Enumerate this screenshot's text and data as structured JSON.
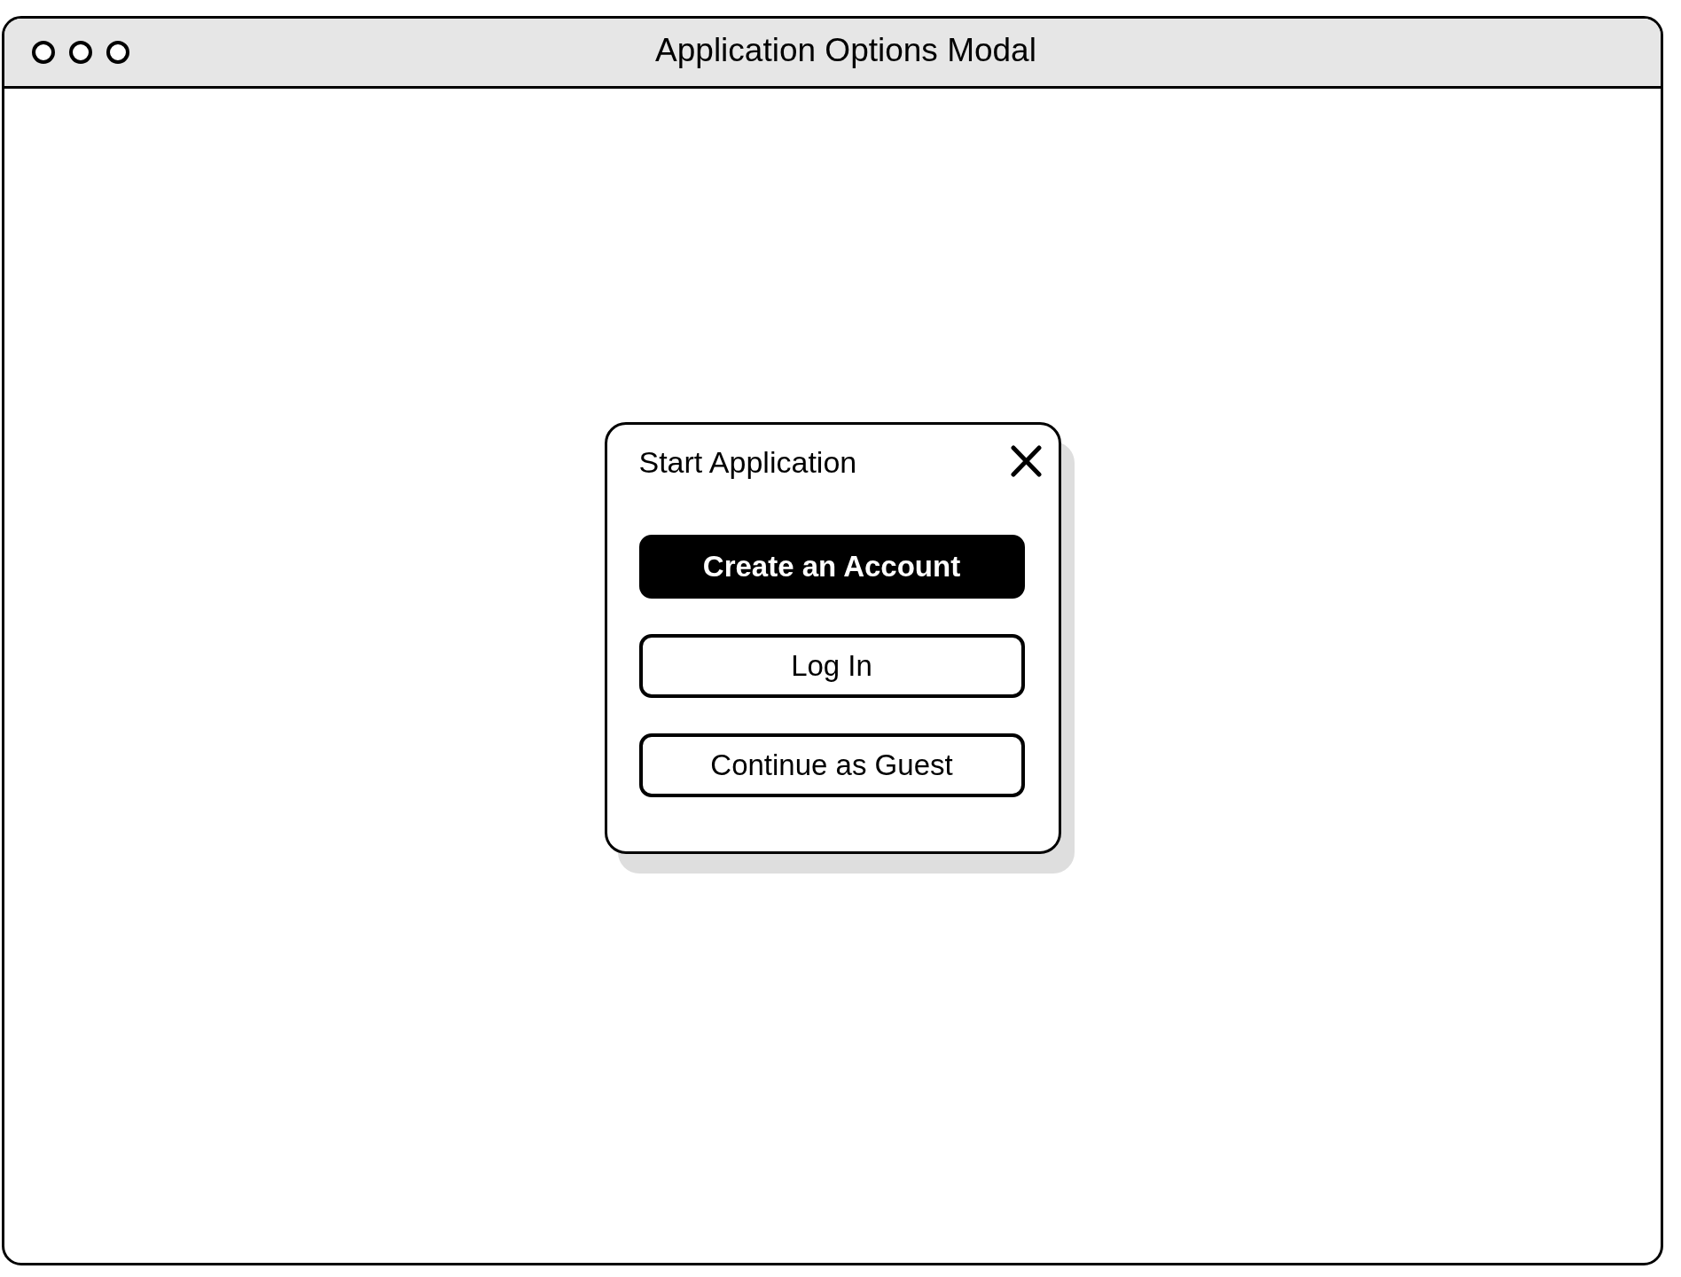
{
  "window": {
    "title": "Application Options Modal"
  },
  "modal": {
    "title": "Start Application",
    "buttons": [
      {
        "label": "Create an Account",
        "kind": "primary"
      },
      {
        "label": "Log In",
        "kind": "secondary"
      },
      {
        "label": "Continue as Guest",
        "kind": "secondary"
      }
    ]
  }
}
